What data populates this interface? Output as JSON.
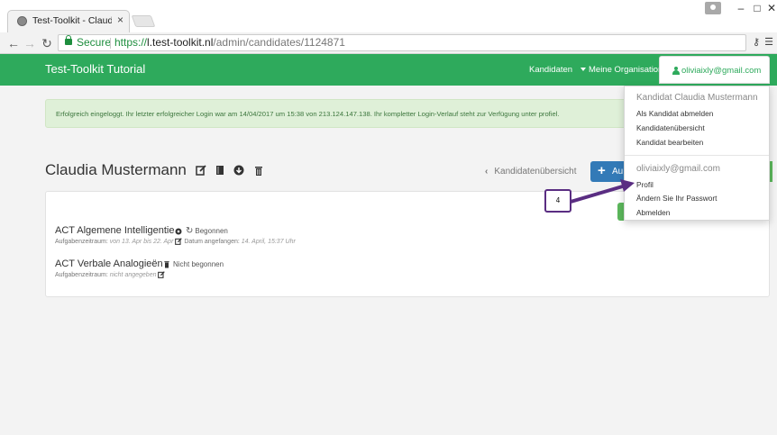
{
  "browser": {
    "tab_title": "Test-Toolkit - Claudia Mu",
    "tab_close": "×",
    "secure_label": "Secure",
    "url_scheme": "https://",
    "url_host": "l.test-toolkit.nl",
    "url_path": "/admin/candidates/1124871",
    "window_controls": {
      "minimize": "–",
      "maximize": "□",
      "close": "✕"
    }
  },
  "navbar": {
    "brand": "Test-Toolkit Tutorial",
    "links": [
      "Kandidaten",
      "Meine Organisation"
    ],
    "user_email": "oliviaixly@gmail.com",
    "color": "#2eaa5c"
  },
  "alert": {
    "text": "Erfolgreich eingeloggt. Ihr letzter erfolgreicher Login war am 14/04/2017 um 15:38 von 213.124.147.138. Ihr kompletter Login-Verlauf steht zur Verfügung unter profiel."
  },
  "candidate": {
    "name": "Claudia Mustermann",
    "back_label": "Kandidatenübersicht",
    "add_label": "Au"
  },
  "tests": [
    {
      "title": "ACT Algemene Intelligentie",
      "status": "Begonnen",
      "meta_prefix": "Aufgabenzeitraum:",
      "meta_value": "von 13. Apr bis 22. Apr",
      "started_label": "Datum angefangen:",
      "started_value": "14. April, 15:37 Uhr"
    },
    {
      "title": "ACT Verbale Analogieën",
      "status": "Nicht begonnen",
      "meta_prefix": "Aufgabenzeitraum:",
      "meta_value": "nicht angegeben"
    }
  ],
  "dropdown": {
    "candidate_header": "Kandidat Claudia Mustermann",
    "candidate_items": [
      "Als Kandidat abmelden",
      "Kandidatenübersicht",
      "Kandidat bearbeiten"
    ],
    "user_header": "oliviaixly@gmail.com",
    "user_items": [
      "Profil",
      "Ändern Sie Ihr Passwort",
      "Abmelden"
    ]
  },
  "annotation": {
    "number": "4",
    "color": "#5a2d82"
  }
}
